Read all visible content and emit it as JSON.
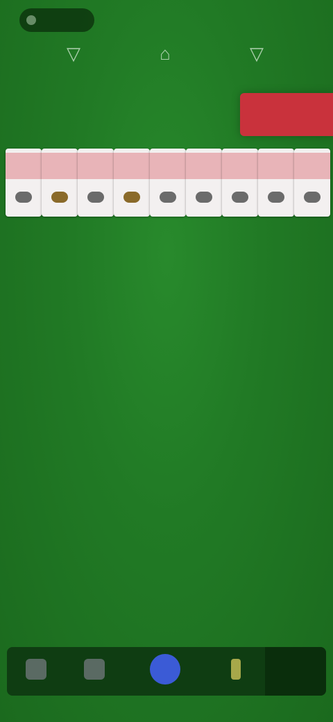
{
  "header": {
    "pill_label": "",
    "stats": [
      {
        "glyph": "▽",
        "value": ""
      },
      {
        "glyph": "⌂",
        "value": ""
      },
      {
        "glyph": "▽",
        "value": ""
      }
    ]
  },
  "board": {
    "felt_color": "#217a25",
    "foundation_color": "#c9323c",
    "cards": [
      {
        "kind": "neutral"
      },
      {
        "kind": "warm"
      },
      {
        "kind": "neutral"
      },
      {
        "kind": "warm"
      },
      {
        "kind": "neutral"
      },
      {
        "kind": "neutral"
      },
      {
        "kind": "neutral"
      },
      {
        "kind": "neutral"
      },
      {
        "kind": "neutral"
      }
    ]
  },
  "bottom_nav": {
    "items": [
      {
        "name": "menu",
        "icon": "menu-icon",
        "label": ""
      },
      {
        "name": "hint",
        "icon": "hint-icon",
        "label": ""
      },
      {
        "name": "play",
        "icon": "play-icon",
        "label": ""
      },
      {
        "name": "undo",
        "icon": "undo-icon",
        "label": ""
      }
    ]
  }
}
